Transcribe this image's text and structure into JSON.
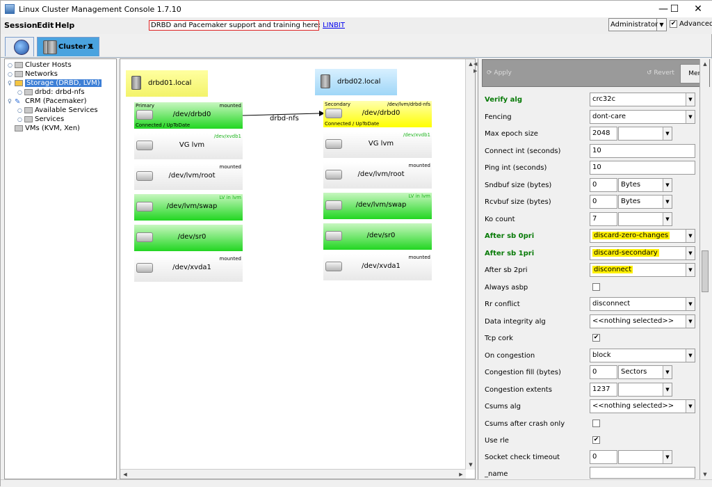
{
  "window": {
    "title": "Linux Cluster Management Console 1.7.10",
    "minimize": "—",
    "maximize": "☐",
    "close": "✕"
  },
  "menubar": {
    "session": "Session",
    "edit": "Edit",
    "help": "Help"
  },
  "banner": {
    "text": "DRBD and Pacemaker support and training here: ",
    "link": "LINBIT"
  },
  "role": {
    "value": "Administrator",
    "advanced_label": "Advanced",
    "advanced_checked": "✔"
  },
  "tabs": {
    "cluster_label": "Cluster 1",
    "close": "X"
  },
  "tree": {
    "cluster_hosts": "Cluster Hosts",
    "networks": "Networks",
    "storage": "Storage (DRBD, LVM)",
    "drbd_res": "drbd: drbd-nfs",
    "crm": "CRM (Pacemaker)",
    "available_services": "Available Services",
    "services": "Services",
    "vms": "VMs (KVM, Xen)"
  },
  "canvas": {
    "host1": "drbd01.local",
    "host2": "drbd02.local",
    "connection_label": "drbd-nfs",
    "left": [
      {
        "name": "/dev/drbd0",
        "tl": "Primary",
        "tr": "mounted",
        "bl": "Connected / UpToDate"
      },
      {
        "name": "VG lvm",
        "tr": "/dev/xvdb1"
      },
      {
        "name": "/dev/lvm/root",
        "tr": "mounted"
      },
      {
        "name": "/dev/lvm/swap",
        "tr": "LV in lvm"
      },
      {
        "name": "/dev/sr0"
      },
      {
        "name": "/dev/xvda1",
        "tr": "mounted"
      }
    ],
    "right": [
      {
        "name": "/dev/drbd0",
        "tl": "Secondary",
        "tr": "/dev/lvm/drbd-nfs",
        "bl": "Connected / UpToDate"
      },
      {
        "name": "VG lvm",
        "tr": "/dev/xvdb1"
      },
      {
        "name": "/dev/lvm/root",
        "tr": "mounted"
      },
      {
        "name": "/dev/lvm/swap",
        "tr": "LV in lvm"
      },
      {
        "name": "/dev/sr0"
      },
      {
        "name": "/dev/xvda1",
        "tr": "mounted"
      }
    ]
  },
  "toolbar": {
    "apply": "Apply",
    "revert": "Revert",
    "menu": "Menu"
  },
  "props": [
    {
      "label": "Verify alg",
      "value": "crc32c"
    },
    {
      "label": "Fencing",
      "value": "dont-care"
    },
    {
      "label": "Max epoch size",
      "value": "2048"
    },
    {
      "label": "Connect int (seconds)",
      "value": "10"
    },
    {
      "label": "Ping int (seconds)",
      "value": "10"
    },
    {
      "label": "Sndbuf size (bytes)",
      "value": "0",
      "unit": "Bytes"
    },
    {
      "label": "Rcvbuf size (bytes)",
      "value": "0",
      "unit": "Bytes"
    },
    {
      "label": "Ko count",
      "value": "7"
    },
    {
      "label": "After sb 0pri",
      "value": "discard-zero-changes"
    },
    {
      "label": "After sb 1pri",
      "value": "discard-secondary"
    },
    {
      "label": "After sb 2pri",
      "value": "disconnect"
    },
    {
      "label": "Always asbp",
      "value": ""
    },
    {
      "label": "Rr conflict",
      "value": "disconnect"
    },
    {
      "label": "Data integrity alg",
      "value": "<<nothing selected>>"
    },
    {
      "label": "Tcp cork",
      "value": "✔"
    },
    {
      "label": "On congestion",
      "value": "block"
    },
    {
      "label": "Congestion fill (bytes)",
      "value": "0",
      "unit": "Sectors"
    },
    {
      "label": "Congestion extents",
      "value": "1237"
    },
    {
      "label": "Csums alg",
      "value": "<<nothing selected>>"
    },
    {
      "label": "Csums after crash only",
      "value": ""
    },
    {
      "label": "Use rle",
      "value": "✔"
    },
    {
      "label": "Socket check timeout",
      "value": "0"
    },
    {
      "label": "_name",
      "value": ""
    }
  ],
  "colors": {
    "green_label": "#077a07",
    "highlight": "#fff000",
    "tab_active": "#4aa3df"
  }
}
